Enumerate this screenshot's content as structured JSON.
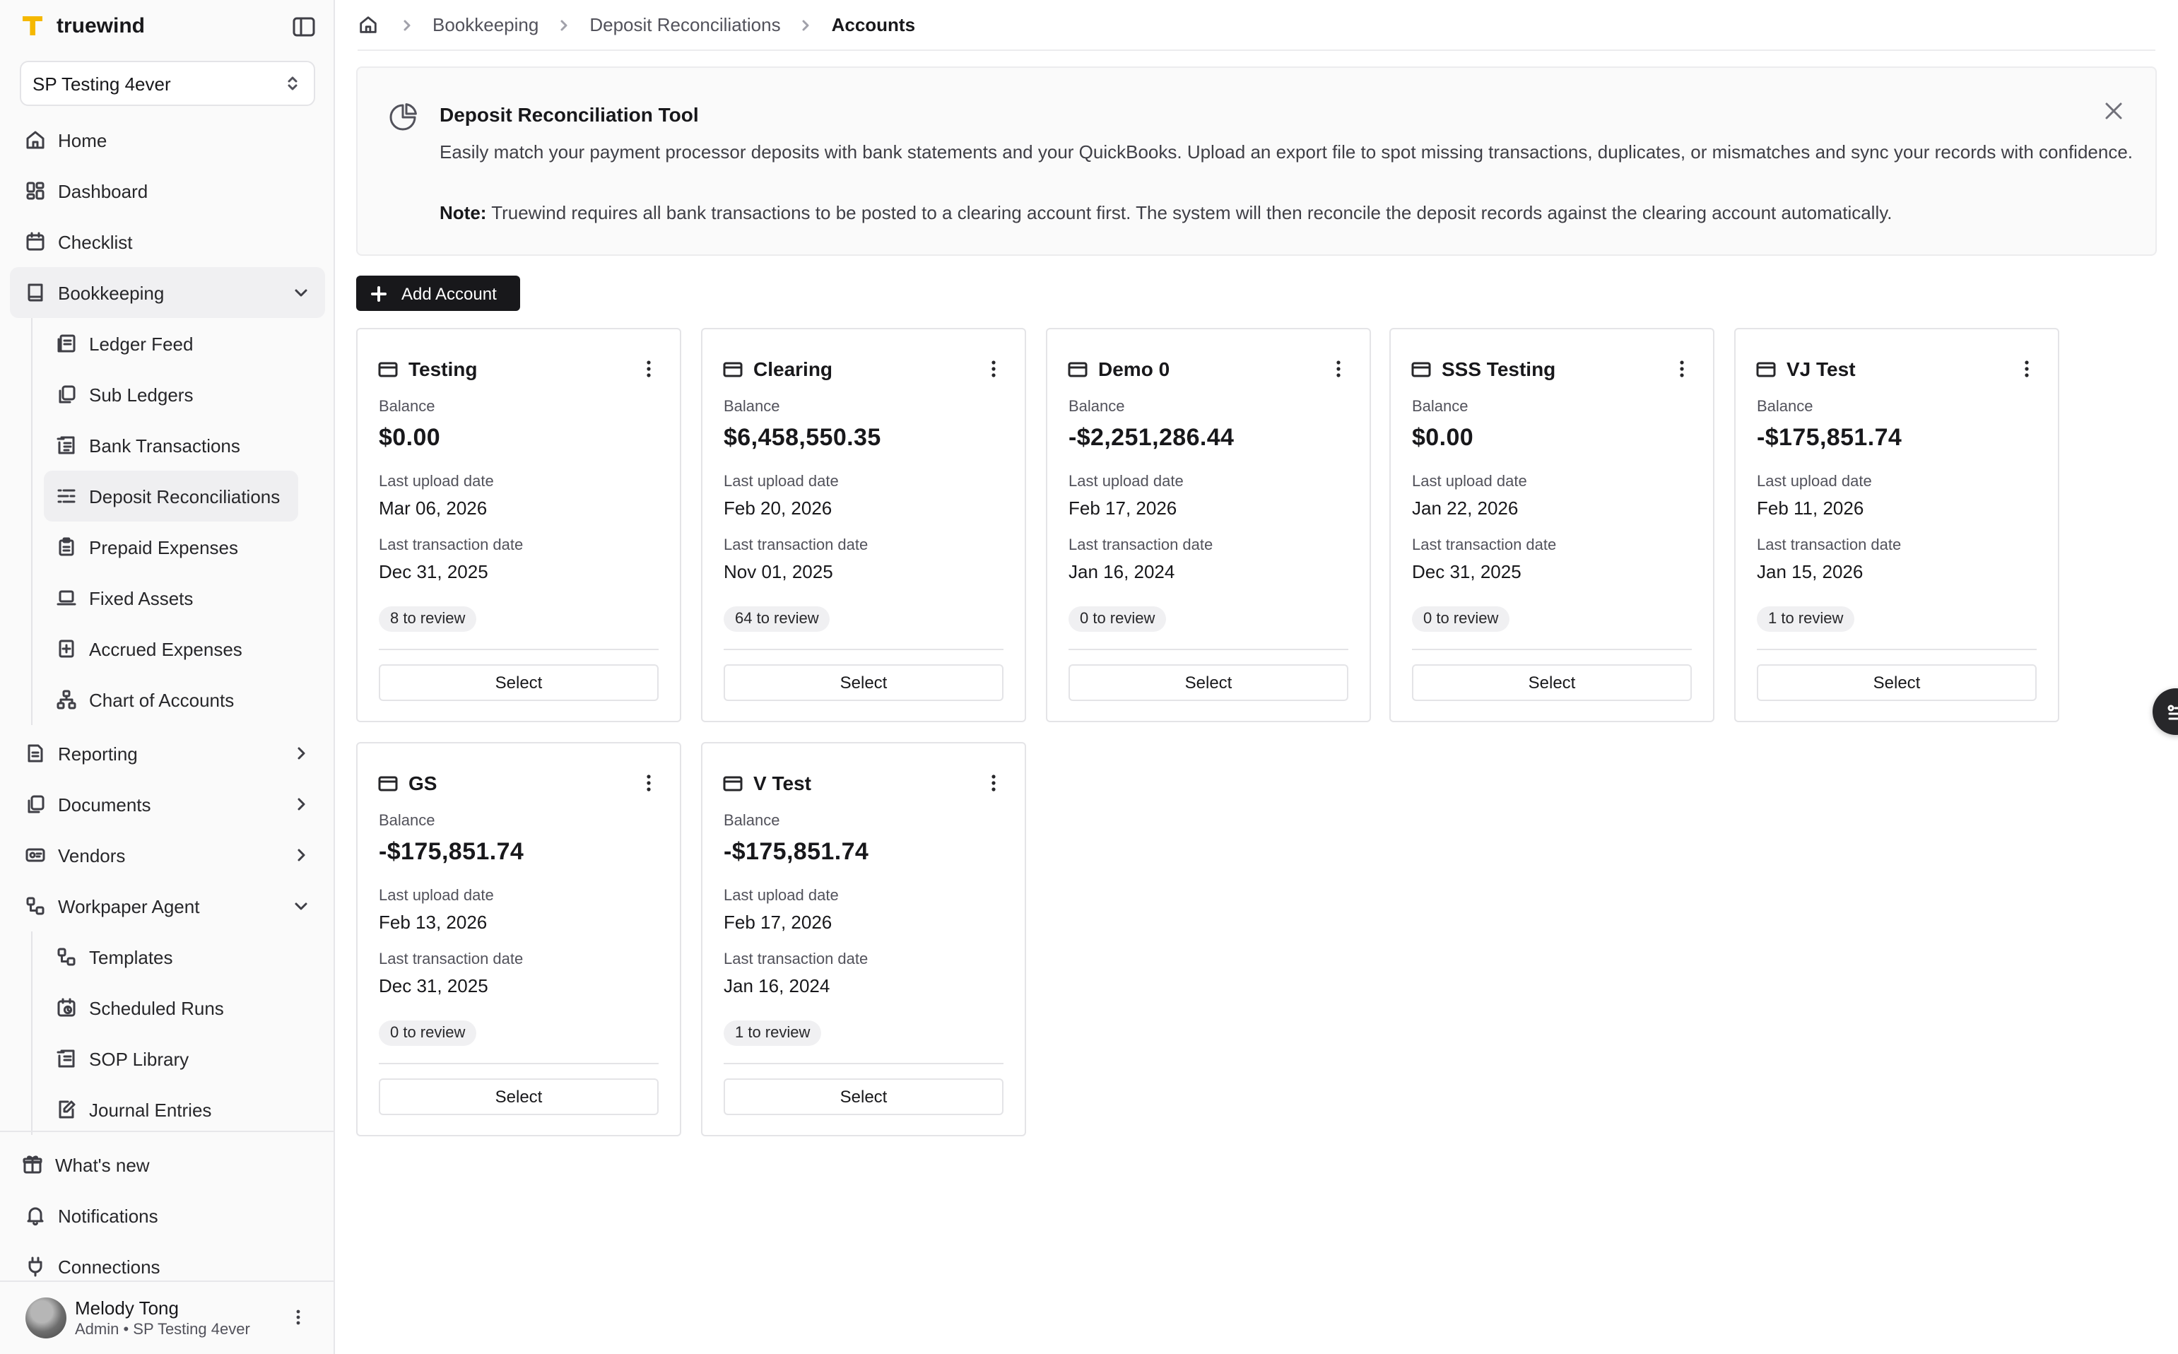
{
  "brand": {
    "name": "truewind",
    "accent": "#f5b800"
  },
  "org": {
    "name": "SP Testing 4ever"
  },
  "nav": {
    "top": [
      {
        "label": "Home",
        "icon": "home-icon"
      },
      {
        "label": "Dashboard",
        "icon": "dashboard-icon"
      },
      {
        "label": "Checklist",
        "icon": "calendar-icon"
      }
    ],
    "bookkeeping": {
      "label": "Bookkeeping",
      "items": [
        {
          "label": "Ledger Feed"
        },
        {
          "label": "Sub Ledgers"
        },
        {
          "label": "Bank Transactions"
        },
        {
          "label": "Deposit Reconciliations"
        },
        {
          "label": "Prepaid Expenses"
        },
        {
          "label": "Fixed Assets"
        },
        {
          "label": "Accrued Expenses"
        },
        {
          "label": "Chart of Accounts"
        }
      ]
    },
    "collapsed": [
      {
        "label": "Reporting"
      },
      {
        "label": "Documents"
      },
      {
        "label": "Vendors"
      }
    ],
    "workpaper": {
      "label": "Workpaper Agent",
      "items": [
        {
          "label": "Templates"
        },
        {
          "label": "Scheduled Runs"
        },
        {
          "label": "SOP Library"
        },
        {
          "label": "Journal Entries"
        }
      ]
    },
    "bottom": [
      {
        "label": "What's new"
      },
      {
        "label": "Notifications"
      },
      {
        "label": "Connections"
      }
    ]
  },
  "user": {
    "name": "Melody Tong",
    "role": "Admin • SP Testing 4ever"
  },
  "breadcrumb": {
    "items": [
      "Bookkeeping",
      "Deposit Reconciliations"
    ],
    "current": "Accounts"
  },
  "banner": {
    "title": "Deposit Reconciliation Tool",
    "text": "Easily match your payment processor deposits with bank statements and your QuickBooks. Upload an export file to spot missing transactions, duplicates, or mismatches and sync your records with confidence.",
    "note_label": "Note:",
    "note_text": " Truewind requires all bank transactions to be posted to a clearing account first. The system will then reconcile the deposit records against the clearing account automatically."
  },
  "toolbar": {
    "add_label": "Add Account"
  },
  "labels": {
    "balance": "Balance",
    "last_upload": "Last upload date",
    "last_txn": "Last transaction date",
    "select": "Select"
  },
  "accounts": [
    {
      "name": "Testing",
      "balance": "$0.00",
      "last_upload": "Mar 06, 2026",
      "last_txn": "Dec 31, 2025",
      "review": "8 to review"
    },
    {
      "name": "Clearing",
      "balance": "$6,458,550.35",
      "last_upload": "Feb 20, 2026",
      "last_txn": "Nov 01, 2025",
      "review": "64 to review"
    },
    {
      "name": "Demo 0",
      "balance": "-$2,251,286.44",
      "last_upload": "Feb 17, 2026",
      "last_txn": "Jan 16, 2024",
      "review": "0 to review"
    },
    {
      "name": "SSS Testing",
      "balance": "$0.00",
      "last_upload": "Jan 22, 2026",
      "last_txn": "Dec 31, 2025",
      "review": "0 to review"
    },
    {
      "name": "VJ Test",
      "balance": "-$175,851.74",
      "last_upload": "Feb 11, 2026",
      "last_txn": "Jan 15, 2026",
      "review": "1 to review"
    },
    {
      "name": "GS",
      "balance": "-$175,851.74",
      "last_upload": "Feb 13, 2026",
      "last_txn": "Dec 31, 2025",
      "review": "0 to review"
    },
    {
      "name": "V Test",
      "balance": "-$175,851.74",
      "last_upload": "Feb 17, 2026",
      "last_txn": "Jan 16, 2024",
      "review": "1 to review"
    }
  ]
}
